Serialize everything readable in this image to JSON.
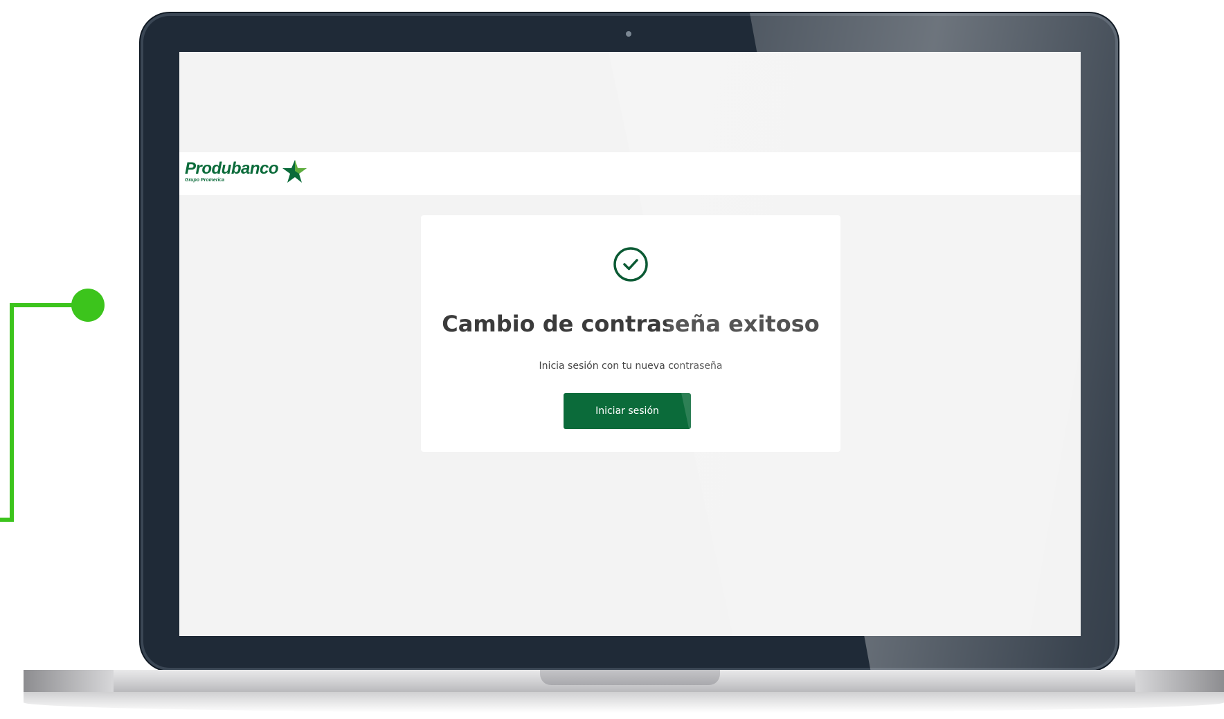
{
  "brand": {
    "name": "Produbanco",
    "subtitle": "Grupo Promerica",
    "logo_icon": "star-icon",
    "color": "#0b6b3a"
  },
  "card": {
    "status_icon": "check-circle-icon",
    "title": "Cambio de contraseña exitoso",
    "subtitle": "Inicia sesión con tu nueva contraseña",
    "button_label": "Iniciar sesión"
  },
  "colors": {
    "accent_green": "#3cc41c",
    "bezel": "#1f2a37",
    "screen_bg": "#f3f3f3"
  }
}
